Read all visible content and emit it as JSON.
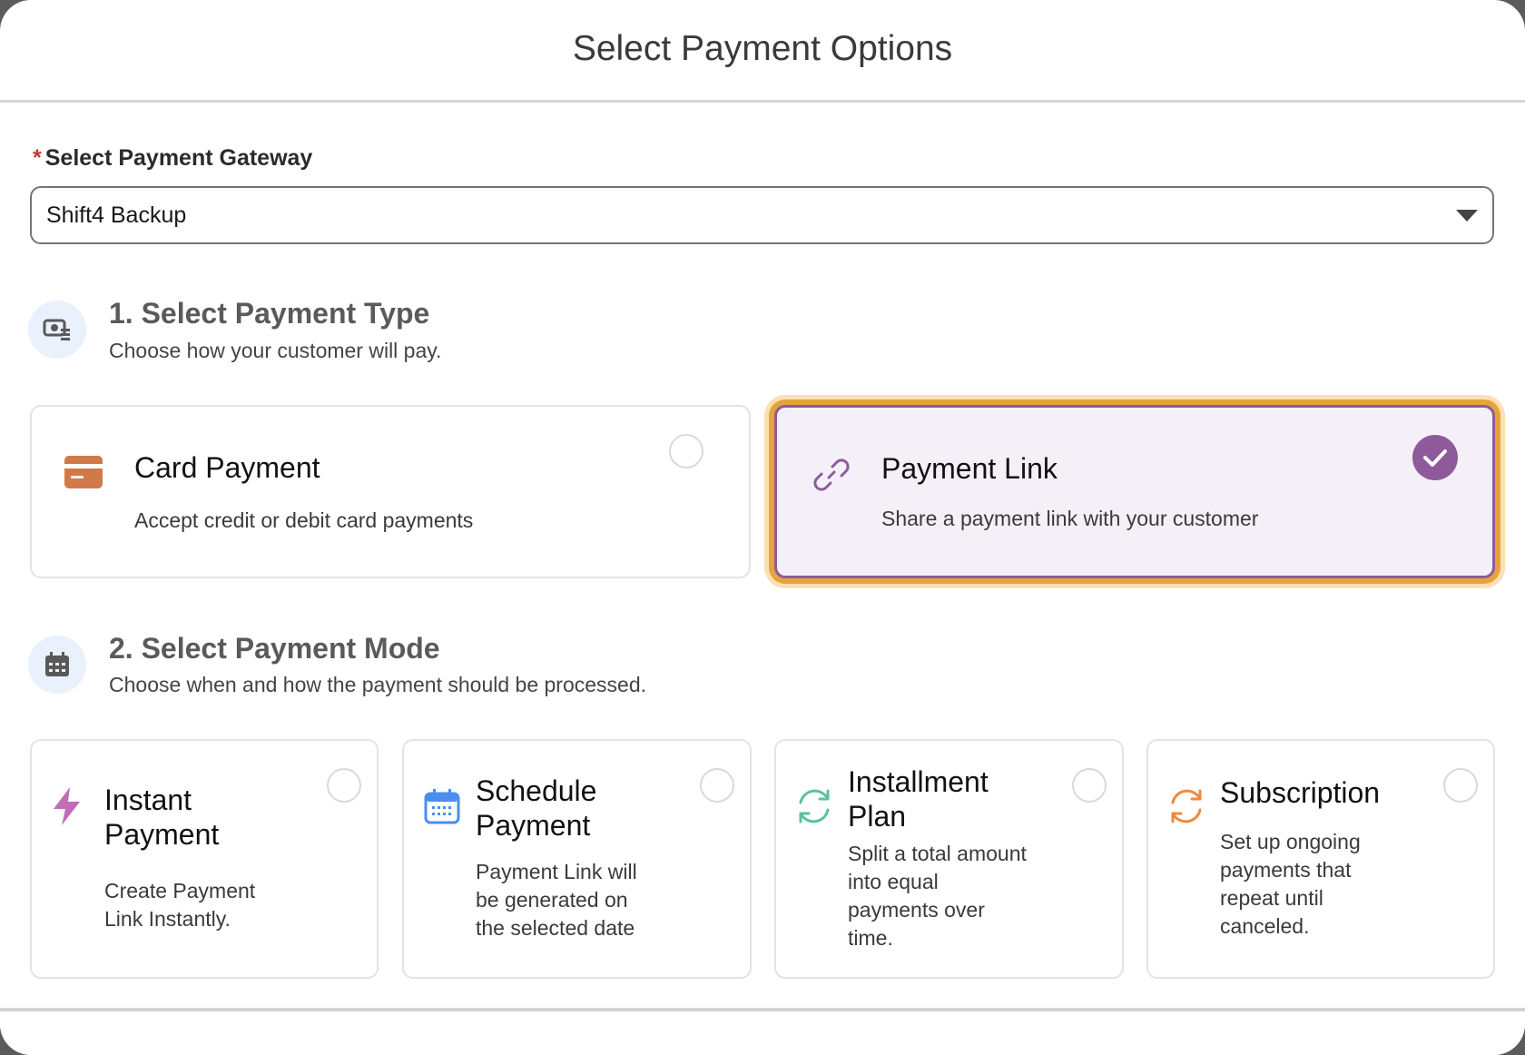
{
  "modal": {
    "title": "Select Payment Options"
  },
  "gateway": {
    "required_mark": "*",
    "label": "Select Payment Gateway",
    "selected": "Shift4 Backup"
  },
  "payment_type": {
    "title": "1. Select Payment Type",
    "subtitle": "Choose how your customer will pay.",
    "options": [
      {
        "title": "Card Payment",
        "description": "Accept credit or debit card payments",
        "icon": "credit-card-icon",
        "selected": false
      },
      {
        "title": "Payment Link",
        "description": "Share a payment link with your customer",
        "icon": "link-icon",
        "selected": true
      }
    ]
  },
  "payment_mode": {
    "title": "2. Select Payment Mode",
    "subtitle": "Choose when and how the payment should be processed.",
    "options": [
      {
        "title_1": "Instant",
        "title_2": "Payment",
        "desc_1": "Create Payment",
        "desc_2": "Link Instantly.",
        "icon": "lightning-icon",
        "selected": false
      },
      {
        "title_1": "Schedule",
        "title_2": "Payment",
        "desc_1": "Payment Link will",
        "desc_2": "be generated on",
        "desc_3": "the selected date",
        "icon": "calendar-icon",
        "selected": false
      },
      {
        "title_1": "Installment",
        "title_2": "Plan",
        "desc_1": "Split a total amount",
        "desc_2": "into equal",
        "desc_3": "payments over",
        "desc_4": "time.",
        "icon": "refresh-icon",
        "selected": false
      },
      {
        "title_1": "Subscription",
        "desc_1": "Set up ongoing",
        "desc_2": "payments that",
        "desc_3": "repeat until",
        "desc_4": "canceled.",
        "icon": "recurring-icon",
        "selected": false
      }
    ]
  },
  "colors": {
    "selected_border": "#8e5a9b",
    "focus_ring": "#e5a43a",
    "card_icon": "#d07a4a",
    "lightning": "#c16db8",
    "calendar": "#4a8ef0",
    "installment": "#5cbfa2",
    "subscription": "#ef8a3c"
  }
}
